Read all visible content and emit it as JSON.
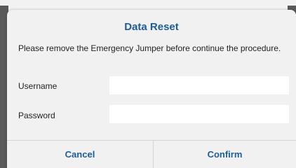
{
  "dialog": {
    "title": "Data Reset",
    "message": "Please remove the Emergency Jumper before continue the procedure.",
    "fields": {
      "username": {
        "label": "Username",
        "value": "",
        "placeholder": ""
      },
      "password": {
        "label": "Password",
        "value": "",
        "placeholder": ""
      }
    },
    "buttons": {
      "cancel": "Cancel",
      "confirm": "Confirm"
    }
  },
  "colors": {
    "accent": "#1b5d96",
    "dialog_background": "#f1f1f1",
    "input_background": "#ffffff",
    "divider": "#d4d4d4"
  }
}
